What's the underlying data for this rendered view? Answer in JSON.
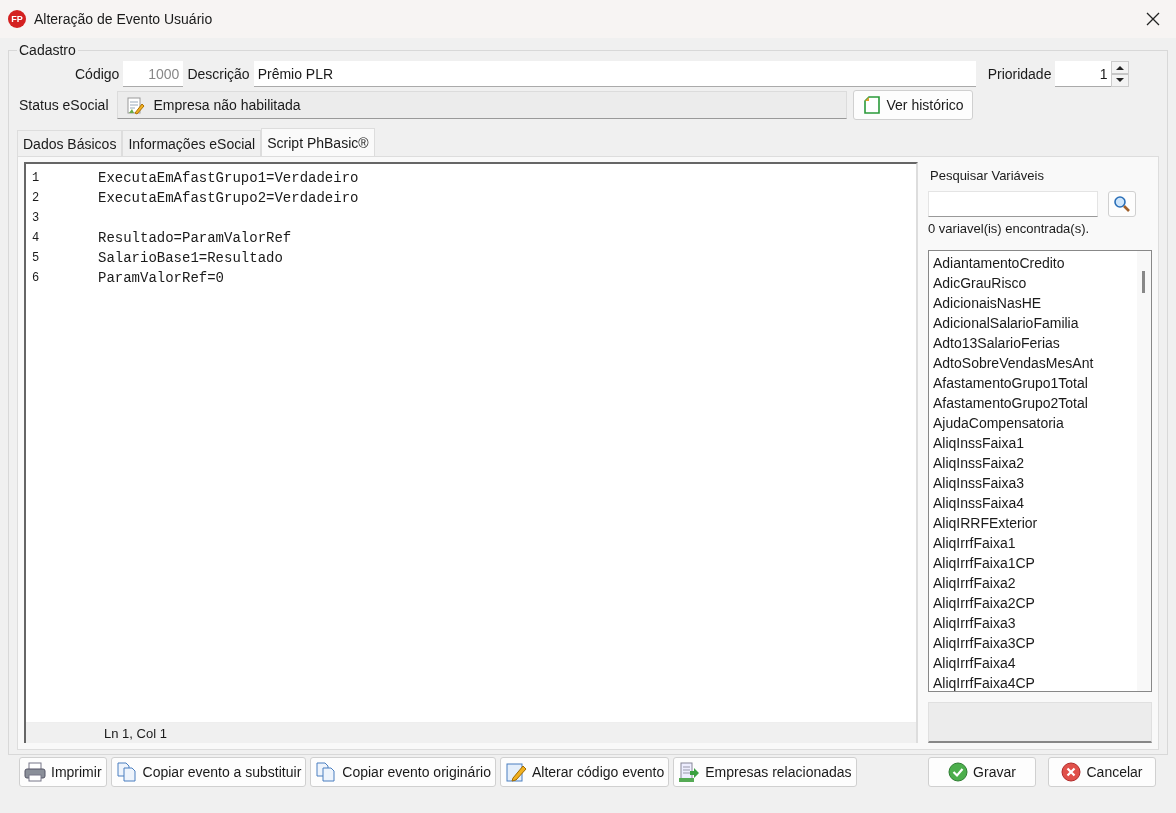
{
  "window": {
    "title": "Alteração de Evento Usuário",
    "logo": "FP"
  },
  "group_title": "Cadastro",
  "codigo": {
    "label": "Código",
    "value": "1000"
  },
  "descricao": {
    "label": "Descrição",
    "value": "Prêmio PLR"
  },
  "prioridade": {
    "label": "Prioridade",
    "value": "1"
  },
  "status": {
    "label": "Status eSocial",
    "value": "Empresa não habilitada"
  },
  "history_button": "Ver histórico",
  "tabs": [
    {
      "label": "Dados Básicos",
      "selected": false
    },
    {
      "label": "Informações eSocial",
      "selected": false
    },
    {
      "label": "Script PhBasic®",
      "selected": true
    }
  ],
  "editor": {
    "lines": [
      {
        "number": "1",
        "code": "ExecutaEmAfastGrupo1=Verdadeiro"
      },
      {
        "number": "2",
        "code": "ExecutaEmAfastGrupo2=Verdadeiro"
      },
      {
        "number": "3"
      },
      {
        "number": "4",
        "code": "Resultado=ParamValorRef"
      },
      {
        "number": "5",
        "code": "SalarioBase1=Resultado"
      },
      {
        "number": "6",
        "code": "ParamValorRef=0"
      }
    ],
    "status": "Ln 1, Col 1"
  },
  "variables": {
    "title": "Pesquisar Variáveis",
    "count": "0 variavel(is) encontrada(s).",
    "items": [
      "AdiantamentoCredito",
      "AdicGrauRisco",
      "AdicionaisNasHE",
      "AdicionalSalarioFamilia",
      "Adto13SalarioFerias",
      "AdtoSobreVendasMesAnt",
      "AfastamentoGrupo1Total",
      "AfastamentoGrupo2Total",
      "AjudaCompensatoria",
      "AliqInssFaixa1",
      "AliqInssFaixa2",
      "AliqInssFaixa3",
      "AliqInssFaixa4",
      "AliqIRRFExterior",
      "AliqIrrfFaixa1",
      "AliqIrrfFaixa1CP",
      "AliqIrrfFaixa2",
      "AliqIrrfFaixa2CP",
      "AliqIrrfFaixa3",
      "AliqIrrfFaixa3CP",
      "AliqIrrfFaixa4",
      "AliqIrrfFaixa4CP"
    ]
  },
  "buttons": [
    {
      "label": "Imprimir",
      "kind": "print"
    },
    {
      "label": "Copiar evento a substituir",
      "kind": "copy"
    },
    {
      "label": "Copiar evento originário",
      "kind": "copy"
    },
    {
      "label": "Alterar código evento",
      "kind": "edit"
    },
    {
      "label": "Empresas relacionadas",
      "kind": "companies"
    }
  ],
  "dialog_buttons": [
    {
      "label": "Gravar",
      "kind": "ok"
    },
    {
      "label": "Cancelar",
      "kind": "cancel"
    }
  ]
}
